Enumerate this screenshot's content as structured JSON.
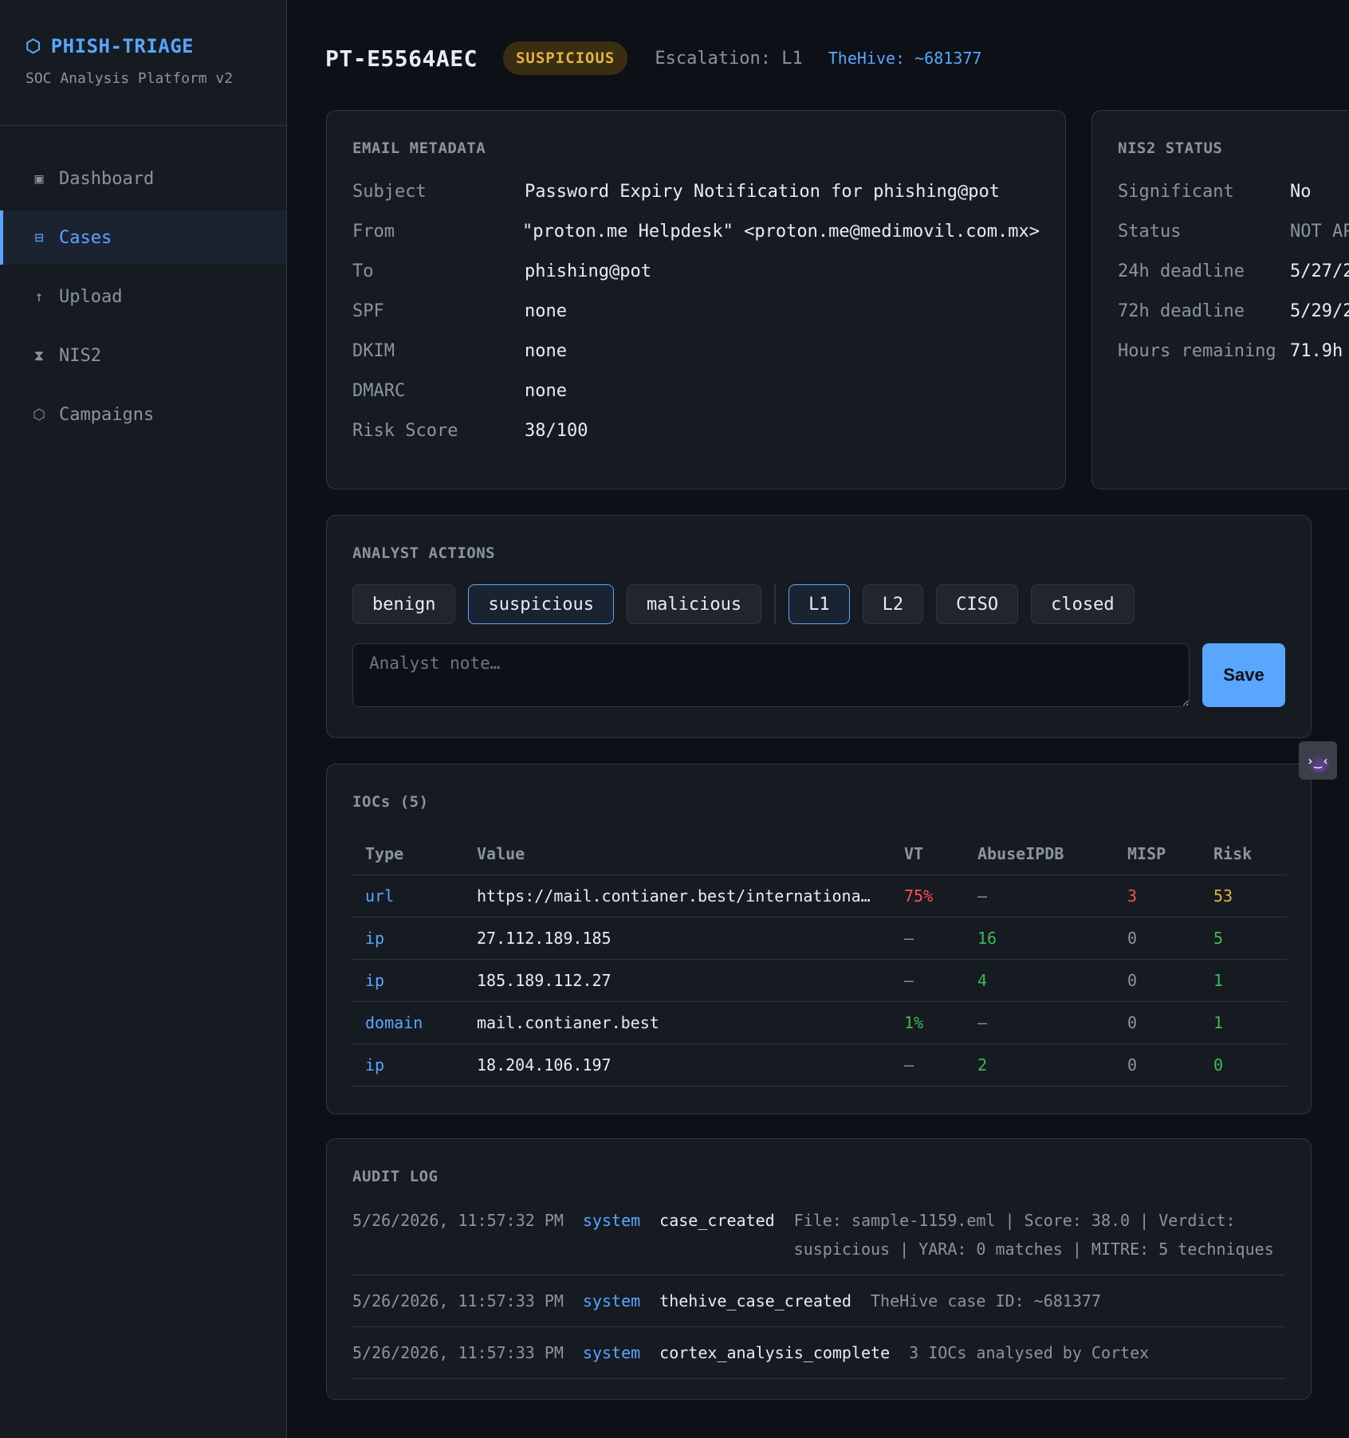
{
  "sidebar": {
    "brand_title": "PHISH-TRIAGE",
    "brand_subtitle": "SOC Analysis Platform v2",
    "items": [
      {
        "label": "Dashboard",
        "icon": "square-icon"
      },
      {
        "label": "Cases",
        "icon": "table-icon",
        "active": true
      },
      {
        "label": "Upload",
        "icon": "arrow-up-icon"
      },
      {
        "label": "NIS2",
        "icon": "hourglass-icon"
      },
      {
        "label": "Campaigns",
        "icon": "hexagon-icon"
      }
    ]
  },
  "header": {
    "case_id": "PT-E5564AEC",
    "verdict": "SUSPICIOUS",
    "escalation": "Escalation: L1",
    "thehive": "TheHive: ~681377"
  },
  "metadata": {
    "title": "EMAIL METADATA",
    "rows": [
      {
        "key": "Subject",
        "value": "Password Expiry Notification for phishing@pot"
      },
      {
        "key": "From",
        "value": "\"proton.me Helpdesk\" <proton.me@medimovil.com.mx>"
      },
      {
        "key": "To",
        "value": "phishing@pot"
      },
      {
        "key": "SPF",
        "value": "none"
      },
      {
        "key": "DKIM",
        "value": "none"
      },
      {
        "key": "DMARC",
        "value": "none"
      },
      {
        "key": "Risk Score",
        "value": "38/100"
      }
    ]
  },
  "nis2": {
    "title": "NIS2 STATUS",
    "rows": [
      {
        "key": "Significant",
        "value": "No"
      },
      {
        "key": "Status",
        "value": "NOT AP"
      },
      {
        "key": "24h deadline",
        "value": "5/27/2"
      },
      {
        "key": "72h deadline",
        "value": "5/29/2"
      },
      {
        "key": "Hours remaining",
        "value": "71.9h"
      }
    ]
  },
  "actions": {
    "title": "ANALYST ACTIONS",
    "verdict_buttons": [
      "benign",
      "suspicious",
      "malicious"
    ],
    "selected_verdict": "suspicious",
    "level_buttons": [
      "L1",
      "L2",
      "CISO",
      "closed"
    ],
    "selected_level": "L1",
    "note_placeholder": "Analyst note…",
    "note_value": "",
    "save_label": "Save"
  },
  "iocs": {
    "title": "IOCs (5)",
    "columns": [
      "Type",
      "Value",
      "VT",
      "AbuseIPDB",
      "MISP",
      "Risk"
    ],
    "rows": [
      {
        "type": "url",
        "value": "https://mail.contianer.best/internationa…",
        "vt": "75%",
        "abuse": "–",
        "misp": "3",
        "risk": "53"
      },
      {
        "type": "ip",
        "value": "27.112.189.185",
        "vt": "–",
        "abuse": "16",
        "misp": "0",
        "risk": "5"
      },
      {
        "type": "ip",
        "value": "185.189.112.27",
        "vt": "–",
        "abuse": "4",
        "misp": "0",
        "risk": "1"
      },
      {
        "type": "domain",
        "value": "mail.contianer.best",
        "vt": "1%",
        "abuse": "–",
        "misp": "0",
        "risk": "1"
      },
      {
        "type": "ip",
        "value": "18.204.106.197",
        "vt": "–",
        "abuse": "2",
        "misp": "0",
        "risk": "0"
      }
    ]
  },
  "audit": {
    "title": "AUDIT LOG",
    "rows": [
      {
        "ts": "5/26/2026, 11:57:32 PM",
        "actor": "system",
        "action": "case_created",
        "detail": "File: sample-1159.eml | Score: 38.0 | Verdict: suspicious | YARA: 0 matches | MITRE: 5 techniques"
      },
      {
        "ts": "5/26/2026, 11:57:33 PM",
        "actor": "system",
        "action": "thehive_case_created",
        "detail": "TheHive case ID: ~681377"
      },
      {
        "ts": "5/26/2026, 11:57:33 PM",
        "actor": "system",
        "action": "cortex_analysis_complete",
        "detail": "3 IOCs analysed by Cortex"
      }
    ]
  },
  "colors": {
    "accent": "#58a6ff",
    "verdict_suspicious": "#e3b341",
    "bad": "#f85149",
    "good": "#3fb950"
  }
}
